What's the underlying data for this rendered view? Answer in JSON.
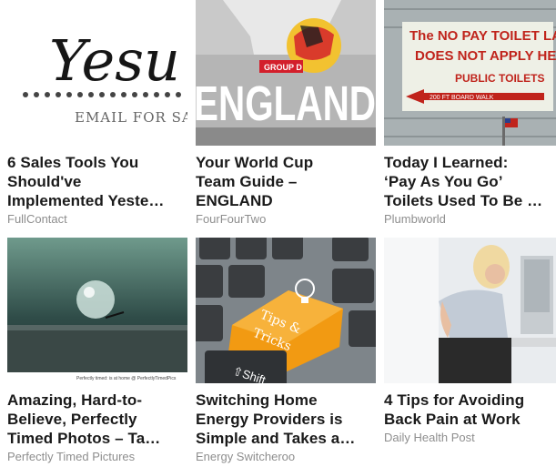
{
  "cards": [
    {
      "title_lines": [
        "6 Sales Tools You",
        "Should've",
        "Implemented Yeste…"
      ],
      "source": "FullContact",
      "thumb": {
        "script_text": "Yesu",
        "sub_text": "EMAIL FOR SAl"
      }
    },
    {
      "title_lines": [
        "Your World Cup",
        "Team Guide –",
        "ENGLAND"
      ],
      "source": "FourFourTwo",
      "thumb": {
        "tag": "GROUP D",
        "big_text": "ENGLAND"
      }
    },
    {
      "title_lines": [
        "Today I Learned:",
        "‘Pay As You Go’",
        "Toilets Used To Be …"
      ],
      "source": "Plumbworld",
      "thumb": {
        "sign_line1": "The NO PAY TOILET LAW",
        "sign_line2": "DOES NOT APPLY HERE",
        "sign_line3": "PUBLIC TOILETS",
        "sign_line4": "200 FT BOARD WALK"
      }
    },
    {
      "title_lines": [
        "Amazing, Hard-to-",
        "Believe, Perfectly",
        "Timed Photos – Ta…"
      ],
      "source": "Perfectly Timed Pictures",
      "thumb": {
        "caption": "Perfectly timed: is at home @ PerfectlyTimedPics"
      }
    },
    {
      "title_lines": [
        "Switching Home",
        "Energy Providers is",
        "Simple and Takes a…"
      ],
      "source": "Energy Switcheroo",
      "thumb": {
        "key_text1": "Tips &",
        "key_text2": "Tricks",
        "shift_text": "⇧Shift"
      }
    },
    {
      "title_lines": [
        "4 Tips for Avoiding",
        "Back Pain at Work"
      ],
      "source": "Daily Health Post",
      "thumb": {}
    }
  ],
  "colors": {
    "title": "#1a1a1a",
    "source": "#8e8e8e",
    "key_orange": "#f29a12"
  }
}
